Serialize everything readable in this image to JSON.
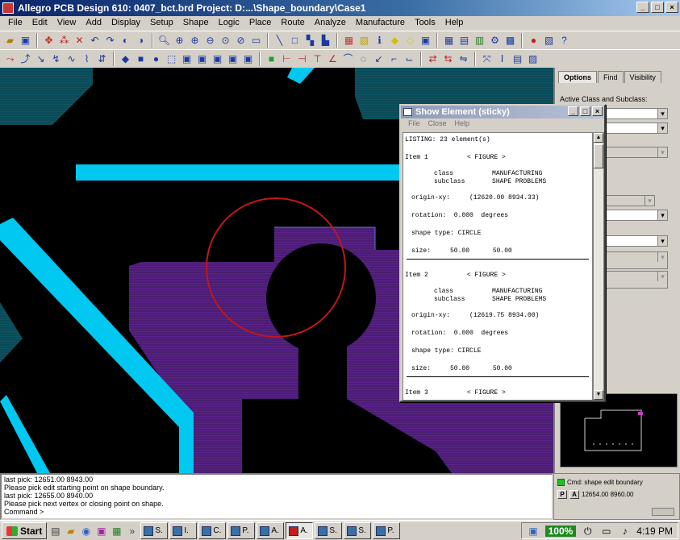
{
  "window": {
    "title": "Allegro PCB Design 610: 0407_bct.brd  Project: D:...\\Shape_boundary\\Case1",
    "btn_min": "_",
    "btn_max": "□",
    "btn_close": "×"
  },
  "menu": [
    "File",
    "Edit",
    "View",
    "Add",
    "Display",
    "Setup",
    "Shape",
    "Logic",
    "Place",
    "Route",
    "Analyze",
    "Manufacture",
    "Tools",
    "Help"
  ],
  "right_pane": {
    "tabs": [
      "Options",
      "Find",
      "Visibility"
    ],
    "active_class_label": "Active Class and Subclass:"
  },
  "show_element": {
    "title": "Show Element (sticky)",
    "menu": [
      "File",
      "Close",
      "Help"
    ],
    "listing_header": "LISTING: 23 element(s)",
    "items": [
      {
        "header": "Item 1          < FIGURE >",
        "class_line": "class          MANUFACTURING",
        "subclass_line": "subclass       SHAPE PROBLEMS",
        "origin_line": "origin-xy:     (12620.00 8934.33)",
        "rotation_line": "rotation:  0.000  degrees",
        "shape_line": "shape type: CIRCLE",
        "size_line": "size:     50.00      50.00"
      },
      {
        "header": "Item 2          < FIGURE >",
        "class_line": "class          MANUFACTURING",
        "subclass_line": "subclass       SHAPE PROBLEMS",
        "origin_line": "origin-xy:     (12619.75 8934.00)",
        "rotation_line": "rotation:  0.000  degrees",
        "shape_line": "shape type: CIRCLE",
        "size_line": "size:     50.00      50.00"
      }
    ],
    "item3_header": "Item 3          < FIGURE >"
  },
  "command_window": {
    "lines": [
      "last pick:  12651.00 8943.00",
      "Please pick edit starting point on shape boundary.",
      "last pick:  12655.00 8940.00",
      "Please pick next vertex or closing point on shape.",
      "Command >"
    ]
  },
  "status": {
    "command": "Cmd:  shape edit boundary",
    "coords": "12654.00 8960.00",
    "p_label": "P",
    "a_label": "A"
  },
  "taskbar": {
    "start": "Start",
    "tasks": [
      "S.",
      "I.",
      "C.",
      "P.",
      "A.",
      "A.",
      "S.",
      "S.",
      "P."
    ],
    "battery": "100%",
    "clock": "4:19 PM"
  }
}
